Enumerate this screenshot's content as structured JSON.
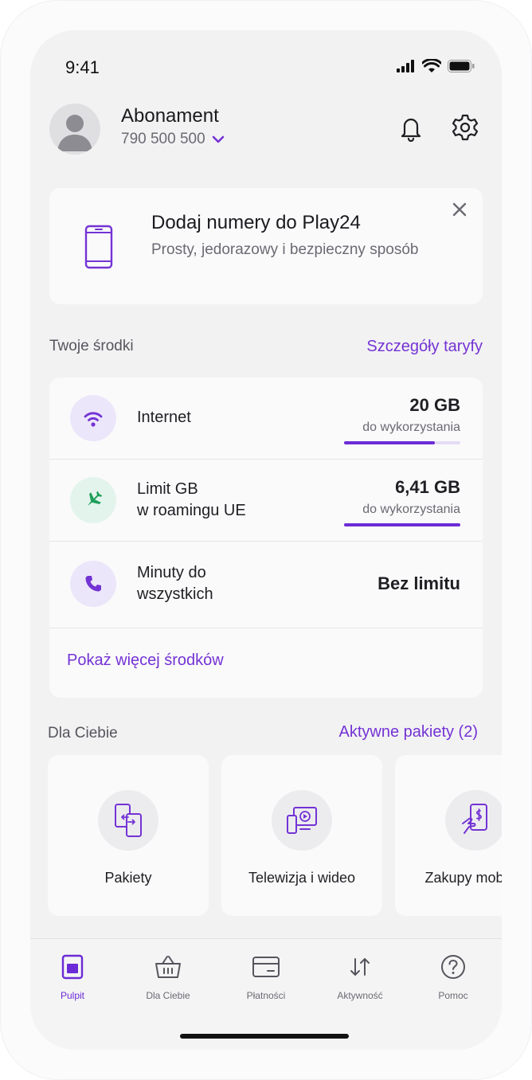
{
  "status_bar": {
    "time": "9:41"
  },
  "header": {
    "plan_title": "Abonament",
    "phone_number": "790 500 500"
  },
  "promo": {
    "title": "Dodaj numery do Play24",
    "subtitle": "Prosty, jedorazowy i bezpieczny sposób"
  },
  "resources_section": {
    "title": "Twoje środki",
    "link": "Szczegóły taryfy"
  },
  "resources": [
    {
      "label": "Internet",
      "value": "20 GB",
      "caption": "do wykorzystania",
      "progress": 0.78,
      "icon": "wifi-icon"
    },
    {
      "label": "Limit GB\nw roamingu UE",
      "value": "6,41 GB",
      "caption": "do wykorzystania",
      "progress": 1.0,
      "icon": "airplane-icon"
    },
    {
      "label": "Minuty do\nwszystkich",
      "value": "Bez limitu",
      "icon": "phone-icon"
    }
  ],
  "show_more": "Pokaż więcej środków",
  "for_you_section": {
    "title": "Dla Ciebie",
    "link": "Aktywne pakiety (2)"
  },
  "tiles": [
    {
      "label": "Pakiety",
      "icon": "packages-icon"
    },
    {
      "label": "Telewizja i wideo",
      "icon": "tv-video-icon"
    },
    {
      "label": "Zakupy mobilne",
      "icon": "mobile-payment-icon"
    }
  ],
  "bottom_nav": [
    {
      "label": "Pulpit",
      "icon": "dashboard-icon",
      "active": true
    },
    {
      "label": "Dla Ciebie",
      "icon": "basket-icon",
      "active": false
    },
    {
      "label": "Płatności",
      "icon": "card-icon",
      "active": false
    },
    {
      "label": "Aktywność",
      "icon": "activity-arrows-icon",
      "active": false
    },
    {
      "label": "Pomoc",
      "icon": "help-icon",
      "active": false
    }
  ],
  "colors": {
    "accent": "#7433d4",
    "card_background": "#fafafb",
    "screen_background": "#f2f2f3",
    "internet_icon_bg": "#ece6fa",
    "roaming_icon_bg": "#e3f4ec",
    "roaming_icon": "#1f9f5a"
  }
}
